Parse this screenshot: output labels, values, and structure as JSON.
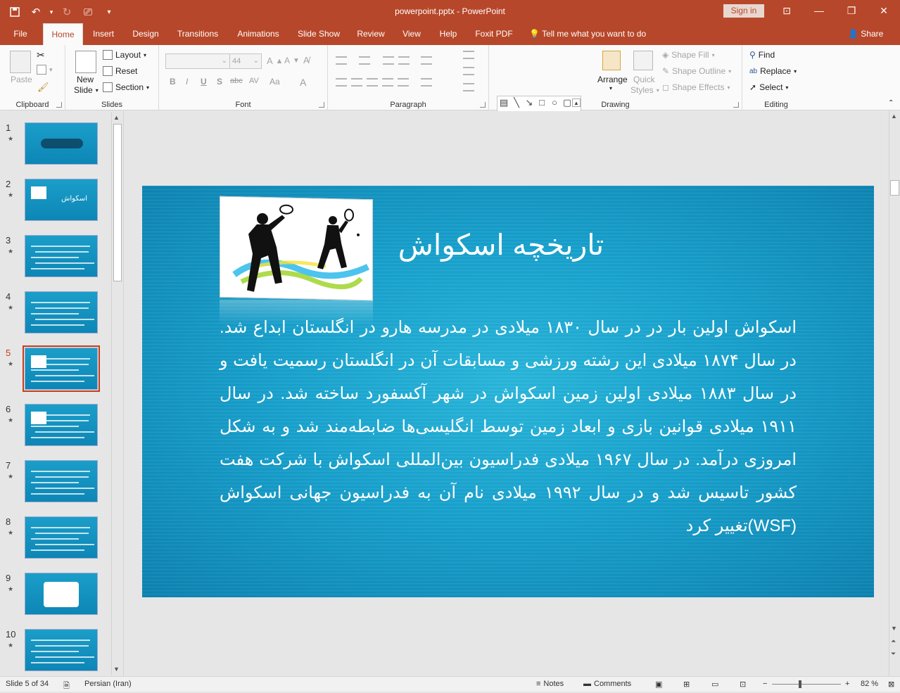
{
  "window": {
    "title": "powerpoint.pptx  -  PowerPoint",
    "signin": "Sign in"
  },
  "tabs": [
    "File",
    "Home",
    "Insert",
    "Design",
    "Transitions",
    "Animations",
    "Slide Show",
    "Review",
    "View",
    "Help",
    "Foxit PDF"
  ],
  "tell_me": "Tell me what you want to do",
  "share": "Share",
  "ribbon": {
    "clipboard": {
      "label": "Clipboard",
      "paste": "Paste"
    },
    "slides": {
      "label": "Slides",
      "new_slide_1": "New",
      "new_slide_2": "Slide",
      "layout": "Layout",
      "reset": "Reset",
      "section": "Section"
    },
    "font": {
      "label": "Font",
      "size": "44",
      "bold": "B",
      "italic": "I",
      "underline": "U",
      "shadow": "S",
      "strike": "abc",
      "spacing": "AV",
      "case": "Aa",
      "color": "A"
    },
    "paragraph": {
      "label": "Paragraph"
    },
    "drawing": {
      "label": "Drawing",
      "arrange": "Arrange",
      "quick_styles_1": "Quick",
      "quick_styles_2": "Styles",
      "shape_fill": "Shape Fill",
      "shape_outline": "Shape Outline",
      "shape_effects": "Shape Effects"
    },
    "editing": {
      "label": "Editing",
      "find": "Find",
      "replace": "Replace",
      "select": "Select"
    }
  },
  "thumbnails": [
    {
      "num": "1",
      "text": ""
    },
    {
      "num": "2",
      "text": "اسکواش"
    },
    {
      "num": "3",
      "text": ""
    },
    {
      "num": "4",
      "text": ""
    },
    {
      "num": "5",
      "text": ""
    },
    {
      "num": "6",
      "text": ""
    },
    {
      "num": "7",
      "text": ""
    },
    {
      "num": "8",
      "text": ""
    },
    {
      "num": "9",
      "text": ""
    },
    {
      "num": "10",
      "text": ""
    }
  ],
  "selected_slide": "5",
  "slide": {
    "title": "تاریخچه اسکواش",
    "body": "اسکواش اولین بار در در سال ۱۸۳۰ میلادی در مدرسه هارو در انگلستان ابداع شد. در سال ۱۸۷۴ میلادی این رشته ورزشی و مسابقات آن در انگلستان رسمیت یافت و در سال ۱۸۸۳ میلادی اولین زمین اسکواش در شهر آکسفورد ساخته شد. در سال ۱۹۱۱ میلادی قوانین بازی و ابعاد زمین توسط انگلیسی‌ها ضابطه‌مند شد و به شکل امروزی درآمد. در سال ۱۹۶۷ میلادی فدراسیون بین‌المللی اسکواش با شرکت هفت کشور تاسیس شد و در سال ۱۹۹۲ میلادی نام آن به فدراسیون جهانی اسکواش  (WSF)تغییر کرد"
  },
  "status": {
    "slide_info": "Slide 5 of 34",
    "language": "Persian (Iran)",
    "notes": "Notes",
    "comments": "Comments",
    "zoom": "82 %"
  },
  "colors": {
    "accent": "#b7472a",
    "slide_bg": "#1aa3cf"
  }
}
